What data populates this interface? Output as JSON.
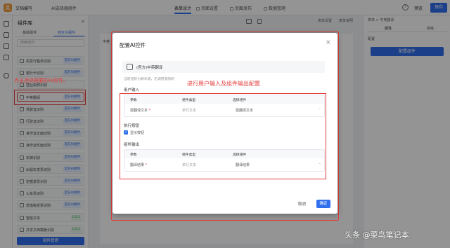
{
  "topbar": {
    "app_title": "文档编写",
    "doc_title": "AI选择器组件",
    "tabs": [
      "表单设计",
      "页面设置",
      "页面发布",
      "数据管理"
    ],
    "preview": "预览",
    "save": "保存",
    "help": "?"
  },
  "panel": {
    "title": "组件库",
    "close": "✕",
    "subtabs": [
      "基础组件",
      "自定义组件"
    ],
    "search_placeholder": "搜索组件",
    "items": [
      {
        "name": "机票行程单识别",
        "badge": "官方AI组件"
      },
      {
        "name": "银行卡识别",
        "badge": "官方AI组件"
      },
      {
        "name": "营业执照识别",
        "badge": ""
      },
      {
        "name": "中英翻译",
        "badge": "官方AI组件"
      },
      {
        "name": "驾驶证识别",
        "badge": "官方AI组件"
      },
      {
        "name": "行驶证识别",
        "badge": "官方AI组件"
      },
      {
        "name": "身份证正面识别",
        "badge": "官方AI组件"
      },
      {
        "name": "身份证反面识别",
        "badge": "官方AI组件"
      },
      {
        "name": "车牌识别",
        "badge": "官方AI组件"
      },
      {
        "name": "出租车发票识别",
        "badge": "官方AI组件"
      },
      {
        "name": "定额发票识别",
        "badge": "官方AI组件"
      },
      {
        "name": "火车票识别",
        "badge": "官方AI组件"
      },
      {
        "name": "增值税发票识别",
        "badge": "官方AI组件"
      },
      {
        "name": "智能文本",
        "badge": "1.0.1"
      },
      {
        "name": "共享文档模板识别",
        "badge": "1.0.1"
      }
    ],
    "manage_button": "组件管理"
  },
  "annotations": {
    "left": "点击选择需要的AI控件。",
    "mid": "进行用户输入及组件输出配置"
  },
  "canvas": {
    "fw_tabs": [
      "表单设置",
      "表单说明"
    ],
    "input_label": "中英"
  },
  "rpanel": {
    "crumb": "表单  >  中英翻译",
    "tabs": [
      "属性",
      "高级"
    ],
    "section": "配置",
    "button": "配置组件"
  },
  "modal": {
    "title": "配置AI控件",
    "close": "×",
    "component_name": "(官方)中英翻译",
    "hint": "当前组织为尊享版，无调用量限制",
    "user_input_label": "用户输入",
    "exec_button_label": "执行按钮",
    "exec_checkbox": "显示按钮",
    "output_label": "组件输出",
    "input_table": {
      "headers": [
        "参数",
        "组件类型",
        "选择组件"
      ],
      "row": {
        "param": "需翻译文本",
        "type": "单行文本",
        "select": "需翻译文本"
      }
    },
    "output_table": {
      "headers": [
        "参数",
        "组件类型",
        "选择组件"
      ],
      "row": {
        "param": "翻译结果",
        "type": "单行文本",
        "select": "翻译结果"
      }
    },
    "cancel": "取消",
    "ok": "确定"
  },
  "watermark": "头条 @菜鸟笔记本"
}
